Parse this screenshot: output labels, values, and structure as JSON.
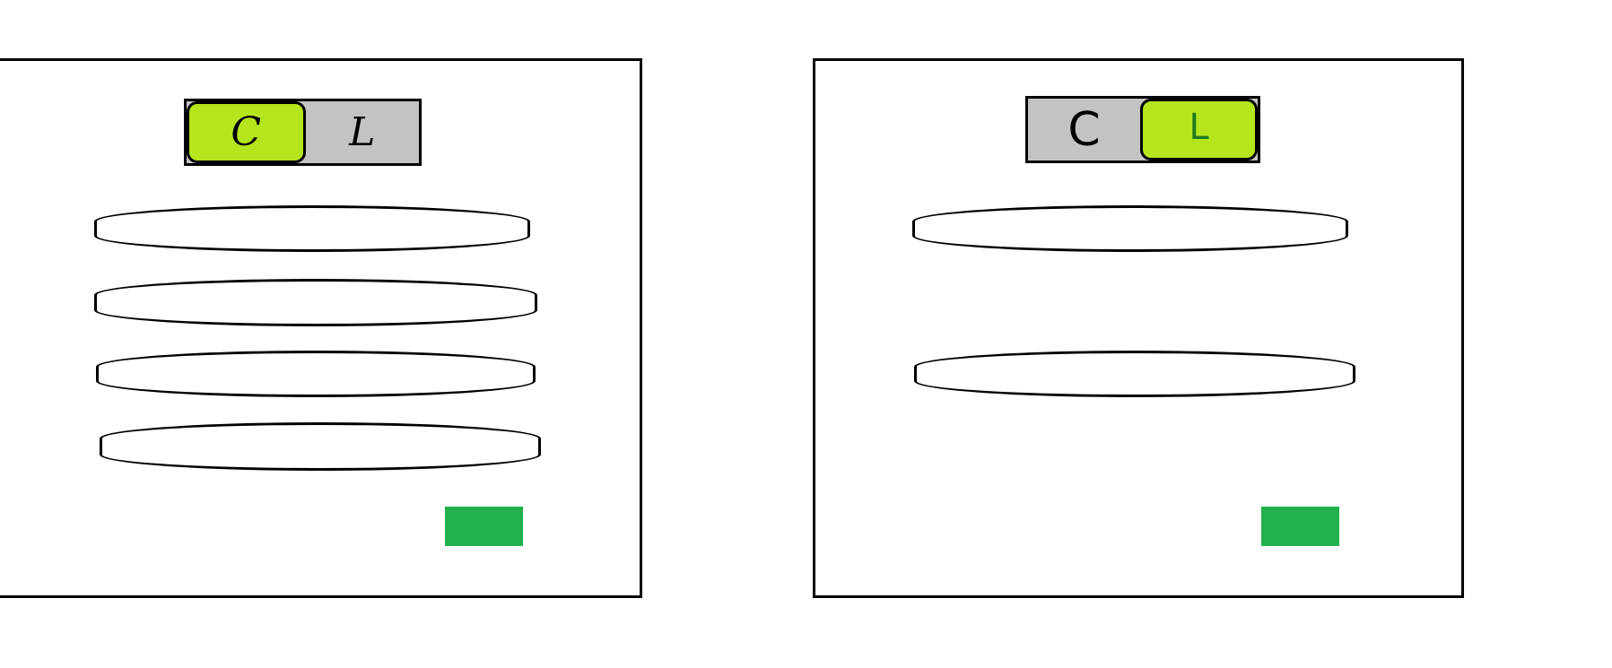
{
  "colors": {
    "active_segment": "#b5e61d",
    "inactive_segment": "#c3c3c3",
    "submit_button": "#22b14c",
    "border": "#000000"
  },
  "left_form": {
    "toggle": {
      "left_label": "C",
      "right_label": "L",
      "active": "left"
    },
    "field_count": 4,
    "submit_label": ""
  },
  "right_form": {
    "toggle": {
      "left_label": "C",
      "right_label": "L",
      "active": "right"
    },
    "field_count": 2,
    "submit_label": ""
  }
}
